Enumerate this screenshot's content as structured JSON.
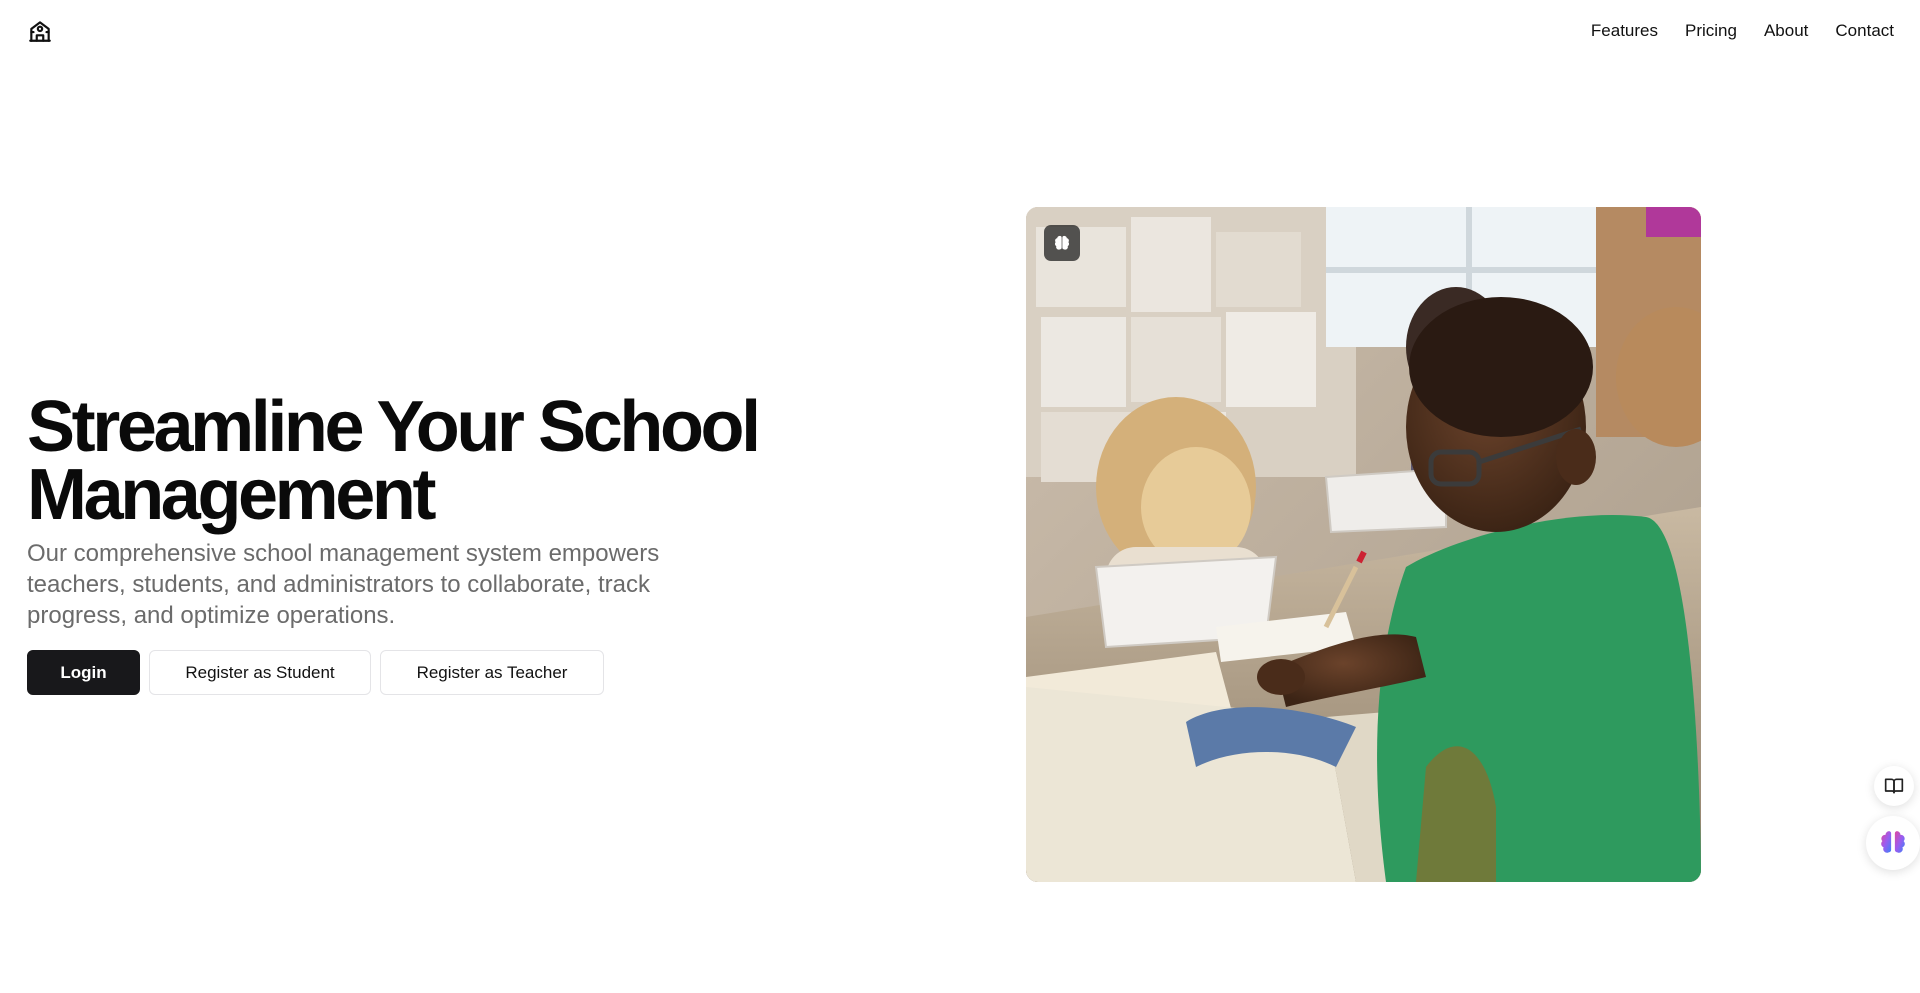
{
  "header": {
    "logo_icon": "school-icon",
    "nav": [
      {
        "label": "Features"
      },
      {
        "label": "Pricing"
      },
      {
        "label": "About"
      },
      {
        "label": "Contact"
      }
    ]
  },
  "hero": {
    "title": "Streamline Your School Management",
    "description": "Our comprehensive school management system empowers teachers, students, and administrators to collaborate, track progress, and optimize operations.",
    "buttons": {
      "login": "Login",
      "register_student": "Register as Student",
      "register_teacher": "Register as Teacher"
    },
    "image_badge_icon": "brain-icon"
  },
  "widgets": {
    "book_icon": "book-open-icon",
    "assistant_icon": "brain-icon"
  },
  "colors": {
    "primary_button": "#18181b",
    "text_muted": "#6b6b6b",
    "shirt_green": "#2e9a5e"
  }
}
